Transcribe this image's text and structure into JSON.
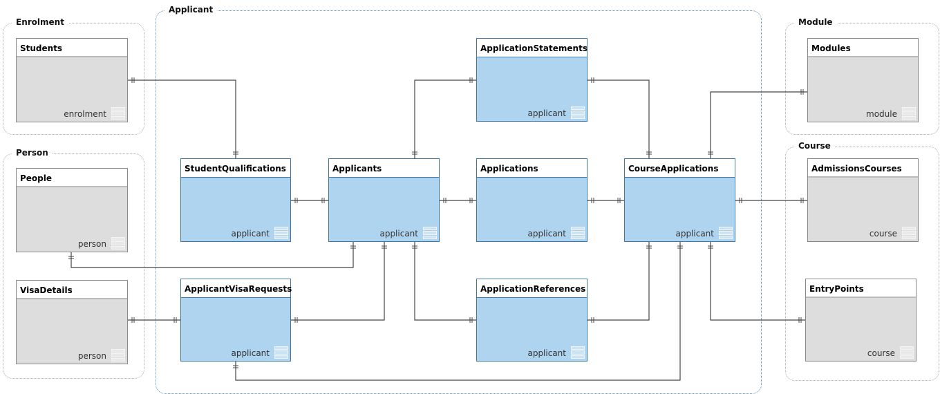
{
  "groups": {
    "enrolment": "Enrolment",
    "person": "Person",
    "applicant": "Applicant",
    "module": "Module",
    "course": "Course"
  },
  "entities": {
    "students": {
      "name": "Students",
      "schema": "enrolment"
    },
    "people": {
      "name": "People",
      "schema": "person"
    },
    "visa_details": {
      "name": "VisaDetails",
      "schema": "person"
    },
    "student_qualifications": {
      "name": "StudentQualifications",
      "schema": "applicant"
    },
    "applicants": {
      "name": "Applicants",
      "schema": "applicant"
    },
    "application_statements": {
      "name": "ApplicationStatements",
      "schema": "applicant"
    },
    "applications": {
      "name": "Applications",
      "schema": "applicant"
    },
    "course_applications": {
      "name": "CourseApplications",
      "schema": "applicant"
    },
    "applicant_visa_requests": {
      "name": "ApplicantVisaRequests",
      "schema": "applicant"
    },
    "application_references": {
      "name": "ApplicationReferences",
      "schema": "applicant"
    },
    "modules": {
      "name": "Modules",
      "schema": "module"
    },
    "admissions_courses": {
      "name": "AdmissionsCourses",
      "schema": "course"
    },
    "entry_points": {
      "name": "EntryPoints",
      "schema": "course"
    }
  },
  "colors": {
    "applicant_entity": "#aed4f0",
    "external_entity": "#dddddd",
    "line": "#444444"
  }
}
